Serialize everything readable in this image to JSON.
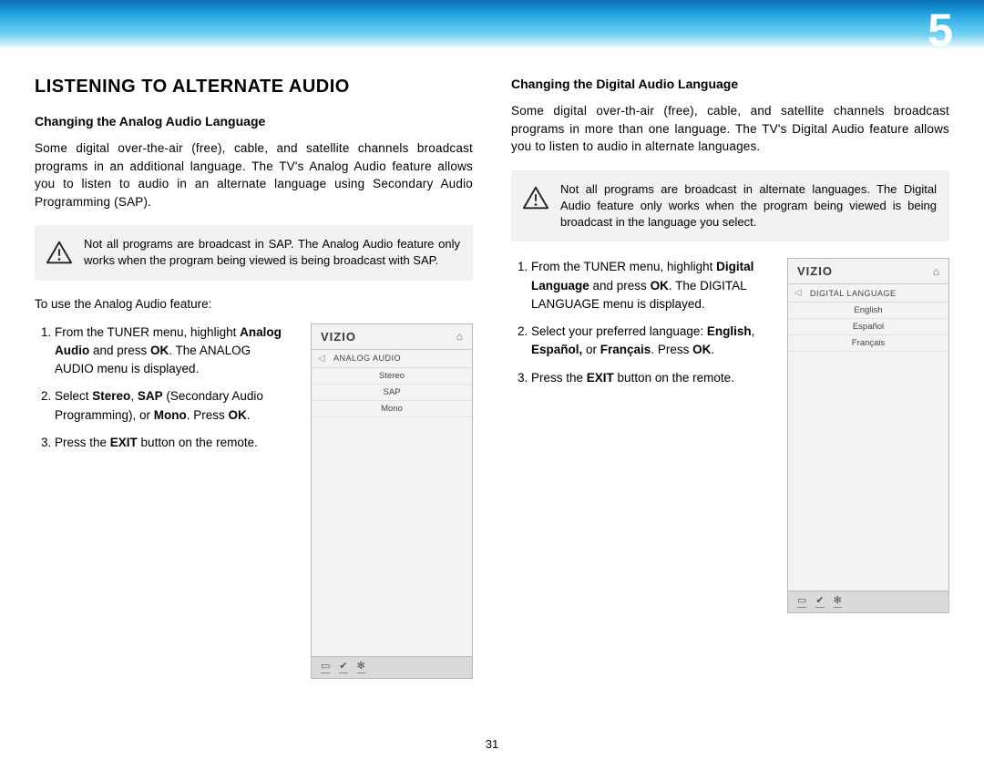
{
  "chapter_number": "5",
  "page_number": "31",
  "left": {
    "heading": "LISTENING TO ALTERNATE AUDIO",
    "subheading": "Changing the Analog Audio Language",
    "intro": "Some digital over-the-air (free), cable, and satellite channels broadcast programs in an additional language. The TV's Analog Audio feature allows you to listen to audio in an alternate language using Secondary Audio Programming (SAP).",
    "warning": "Not all programs are broadcast in SAP. The Analog Audio feature only works when the program being viewed is being broadcast with SAP.",
    "lead": "To use the Analog Audio feature:",
    "steps": {
      "s1_a": "From the TUNER menu, highlight ",
      "s1_b": "Analog Audio",
      "s1_c": " and press ",
      "s1_d": "OK",
      "s1_e": ". The ANALOG AUDIO menu is displayed.",
      "s2_a": "Select ",
      "s2_b": "Stereo",
      "s2_c": ", ",
      "s2_d": "SAP",
      "s2_e": " (Secondary Audio Programming), or ",
      "s2_f": "Mono",
      "s2_g": ". Press ",
      "s2_h": "OK",
      "s2_i": ".",
      "s3_a": "Press the ",
      "s3_b": "EXIT",
      "s3_c": " button on the remote."
    },
    "menu": {
      "logo": "VIZIO",
      "title": "ANALOG AUDIO",
      "options": [
        "Stereo",
        "SAP",
        "Mono"
      ]
    }
  },
  "right": {
    "subheading": "Changing the Digital Audio Language",
    "intro": "Some digital over-th-air (free), cable, and satellite channels broadcast programs in more than one language. The TV's Digital Audio feature allows you to listen to audio in alternate languages.",
    "warning": "Not all programs are broadcast in alternate languages. The Digital Audio feature only works when the program being viewed is being broadcast in the language you select.",
    "steps": {
      "s1_a": "From the TUNER menu, highlight ",
      "s1_b": "Digital Language",
      "s1_c": " and press ",
      "s1_d": "OK",
      "s1_e": ". The DIGITAL LANGUAGE menu is displayed.",
      "s2_a": "Select your preferred language: ",
      "s2_b": "English",
      "s2_c": ", ",
      "s2_d": "Español,",
      "s2_e": " or ",
      "s2_f": "Français",
      "s2_g": ". Press ",
      "s2_h": "OK",
      "s2_i": ".",
      "s3_a": "Press the ",
      "s3_b": "EXIT",
      "s3_c": " button on the remote."
    },
    "menu": {
      "logo": "VIZIO",
      "title": "DIGITAL LANGUAGE",
      "options": [
        "English",
        "Español",
        "Français"
      ]
    }
  }
}
